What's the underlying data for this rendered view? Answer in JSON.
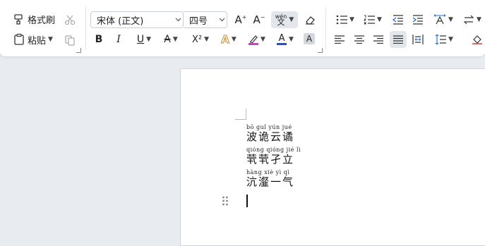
{
  "clipboard": {
    "format_painter_label": "格式刷",
    "paste_label": "粘贴"
  },
  "font": {
    "family_value": "宋体 (正文)",
    "size_value": "四号"
  },
  "font_tools": {
    "grow_icon": "A⁺",
    "shrink_icon": "A⁻",
    "pinyin_icon": "wén 文",
    "bold": "B",
    "italic": "I",
    "underline": "U",
    "strike": "A",
    "superscript": "X²",
    "text_effect": "A",
    "highlight": "A",
    "font_color": "A",
    "char_shading": "A",
    "highlight_color": "#d838d8",
    "font_color_value": "#1f4fd8"
  },
  "document": {
    "lines": [
      {
        "pinyin": "bō guǐ yún jué",
        "text": "波诡云谲"
      },
      {
        "pinyin": "qióng qióng jié lì",
        "text": "茕茕孑立"
      },
      {
        "pinyin": "hàng xiè yì qì",
        "text": "沆瀣一气"
      }
    ]
  }
}
